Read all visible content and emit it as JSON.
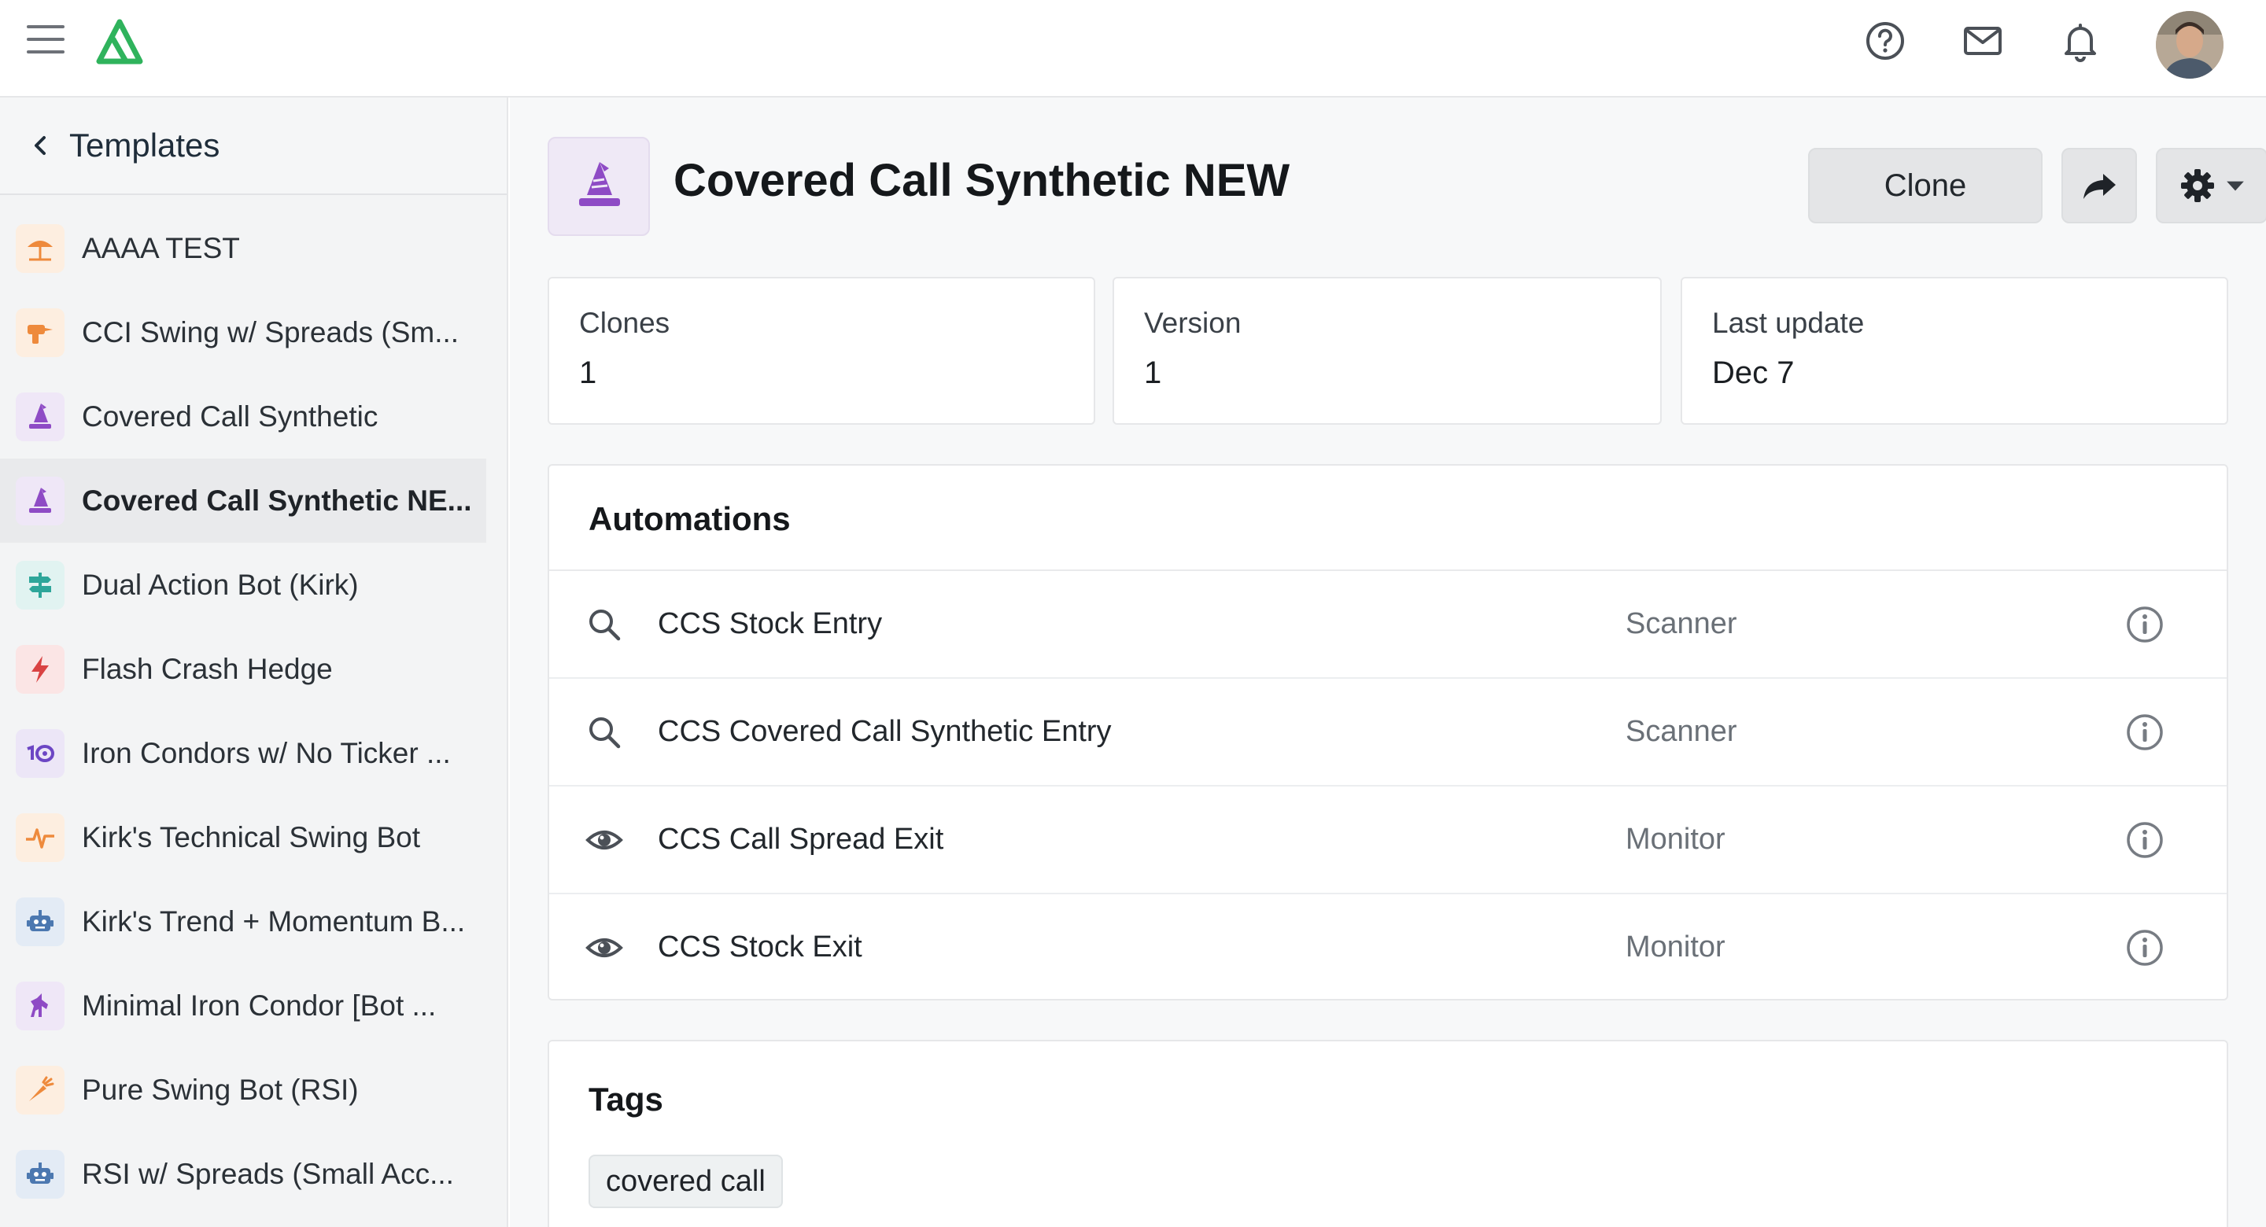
{
  "header": {
    "icons": [
      "menu-icon",
      "logo",
      "help-icon",
      "mail-icon",
      "bell-icon",
      "avatar"
    ]
  },
  "sidebar": {
    "title": "Templates",
    "items": [
      {
        "label": "AAAA TEST",
        "icon": "umbrella-icon",
        "bg": "#fdeee0",
        "fg": "#ee8a3c"
      },
      {
        "label": "CCI Swing w/ Spreads (Sm...",
        "icon": "drill-icon",
        "bg": "#fdeee0",
        "fg": "#ee8a3c"
      },
      {
        "label": "Covered Call Synthetic",
        "icon": "wizard-icon",
        "bg": "#efe7f7",
        "fg": "#8e4bc5"
      },
      {
        "label": "Covered Call Synthetic NE...",
        "icon": "wizard-icon",
        "bg": "#efe7f7",
        "fg": "#8e4bc5",
        "active": true
      },
      {
        "label": "Dual Action Bot (Kirk)",
        "icon": "signpost-icon",
        "bg": "#e1f3f1",
        "fg": "#2ea69a"
      },
      {
        "label": "Flash Crash Hedge",
        "icon": "bolt-icon",
        "bg": "#fbe5e5",
        "fg": "#d94343"
      },
      {
        "label": "Iron Condors w/ No Ticker ...",
        "icon": "ten-percent-icon",
        "bg": "#ece6f7",
        "fg": "#6c46c4"
      },
      {
        "label": "Kirk's Technical Swing Bot",
        "icon": "pulse-icon",
        "bg": "#fdeee0",
        "fg": "#ee8a3c"
      },
      {
        "label": "Kirk's Trend + Momentum B...",
        "icon": "robot-icon",
        "bg": "#e3ebf5",
        "fg": "#4c78b0"
      },
      {
        "label": "Minimal Iron Condor [Bot ...",
        "icon": "unicorn-icon",
        "bg": "#efe7f7",
        "fg": "#8e4bc5"
      },
      {
        "label": "Pure Swing Bot (RSI)",
        "icon": "carrot-icon",
        "bg": "#fdeee0",
        "fg": "#ee8a3c"
      },
      {
        "label": "RSI w/ Spreads (Small Acc...",
        "icon": "robot-icon",
        "bg": "#e3ebf5",
        "fg": "#4c78b0"
      }
    ]
  },
  "main": {
    "title": "Covered Call Synthetic NEW",
    "clone_label": "Clone",
    "stats": [
      {
        "key": "Clones",
        "value": "1"
      },
      {
        "key": "Version",
        "value": "1"
      },
      {
        "key": "Last update",
        "value": "Dec 7"
      }
    ],
    "automations": {
      "title": "Automations",
      "rows": [
        {
          "name": "CCS Stock Entry",
          "type": "Scanner",
          "icon": "search-icon"
        },
        {
          "name": "CCS Covered Call Synthetic Entry",
          "type": "Scanner",
          "icon": "search-icon"
        },
        {
          "name": "CCS Call Spread Exit",
          "type": "Monitor",
          "icon": "eye-icon"
        },
        {
          "name": "CCS Stock Exit",
          "type": "Monitor",
          "icon": "eye-icon"
        }
      ]
    },
    "tags": {
      "title": "Tags",
      "items": [
        "covered call"
      ]
    }
  },
  "colors": {
    "accent_green": "#2fb35c",
    "wizard_purple": "#8e4bc5"
  }
}
